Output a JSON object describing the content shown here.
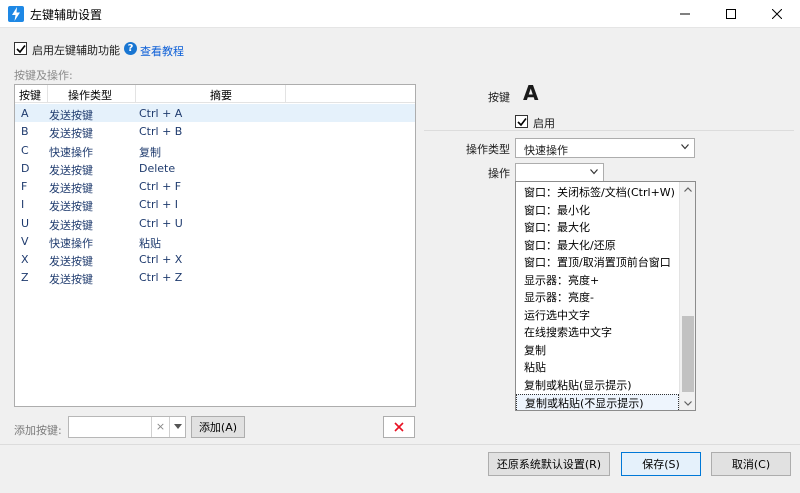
{
  "window": {
    "title": "左键辅助设置",
    "minimize_glyph": "—",
    "maximize_glyph": "☐",
    "close_glyph": "✕",
    "icon": "lightning-icon"
  },
  "enable": {
    "checked": true,
    "label": "启用左键辅助功能",
    "help_link": "查看教程",
    "help_icon": "question-icon"
  },
  "keys_section": {
    "label": "按键及操作:",
    "headers": {
      "key": "按键",
      "type": "操作类型",
      "summary": "摘要"
    },
    "rows": [
      {
        "key": "A",
        "type": "发送按键",
        "summary": "Ctrl + A"
      },
      {
        "key": "B",
        "type": "发送按键",
        "summary": "Ctrl + B"
      },
      {
        "key": "C",
        "type": "快速操作",
        "summary": "复制"
      },
      {
        "key": "D",
        "type": "发送按键",
        "summary": "Delete"
      },
      {
        "key": "F",
        "type": "发送按键",
        "summary": "Ctrl + F"
      },
      {
        "key": "I",
        "type": "发送按键",
        "summary": "Ctrl + I"
      },
      {
        "key": "U",
        "type": "发送按键",
        "summary": "Ctrl + U"
      },
      {
        "key": "V",
        "type": "快速操作",
        "summary": "粘贴"
      },
      {
        "key": "X",
        "type": "发送按键",
        "summary": "Ctrl + X"
      },
      {
        "key": "Z",
        "type": "发送按键",
        "summary": "Ctrl + Z"
      }
    ],
    "selected_row": 0
  },
  "add_key": {
    "label": "添加按键:",
    "value": "",
    "clear_glyph": "×",
    "add_button": "添加(A)",
    "delete_glyph": "✕"
  },
  "detail": {
    "key_label": "按键",
    "key_value": "A",
    "enable_label": "启用",
    "enable_checked": true,
    "op_type_label": "操作类型",
    "op_type_value": "快速操作",
    "op_label": "操作",
    "op_value": ""
  },
  "dropdown": {
    "items": [
      "窗口：关闭标签/文档(Ctrl+W)",
      "窗口：最小化",
      "窗口：最大化",
      "窗口：最大化/还原",
      "窗口：置顶/取消置顶前台窗口",
      "显示器：亮度+",
      "显示器：亮度-",
      "运行选中文字",
      "在线搜索选中文字",
      "复制",
      "粘贴",
      "复制或粘贴(显示提示)",
      "复制或粘贴(不显示提示)"
    ],
    "focused_index": 12
  },
  "footer": {
    "restore": "还原系统默认设置(R)",
    "save": "保存(S)",
    "cancel": "取消(C)"
  },
  "colors": {
    "accent": "#0078d7",
    "delete_red": "#e81123",
    "link": "#0b5ed7"
  }
}
